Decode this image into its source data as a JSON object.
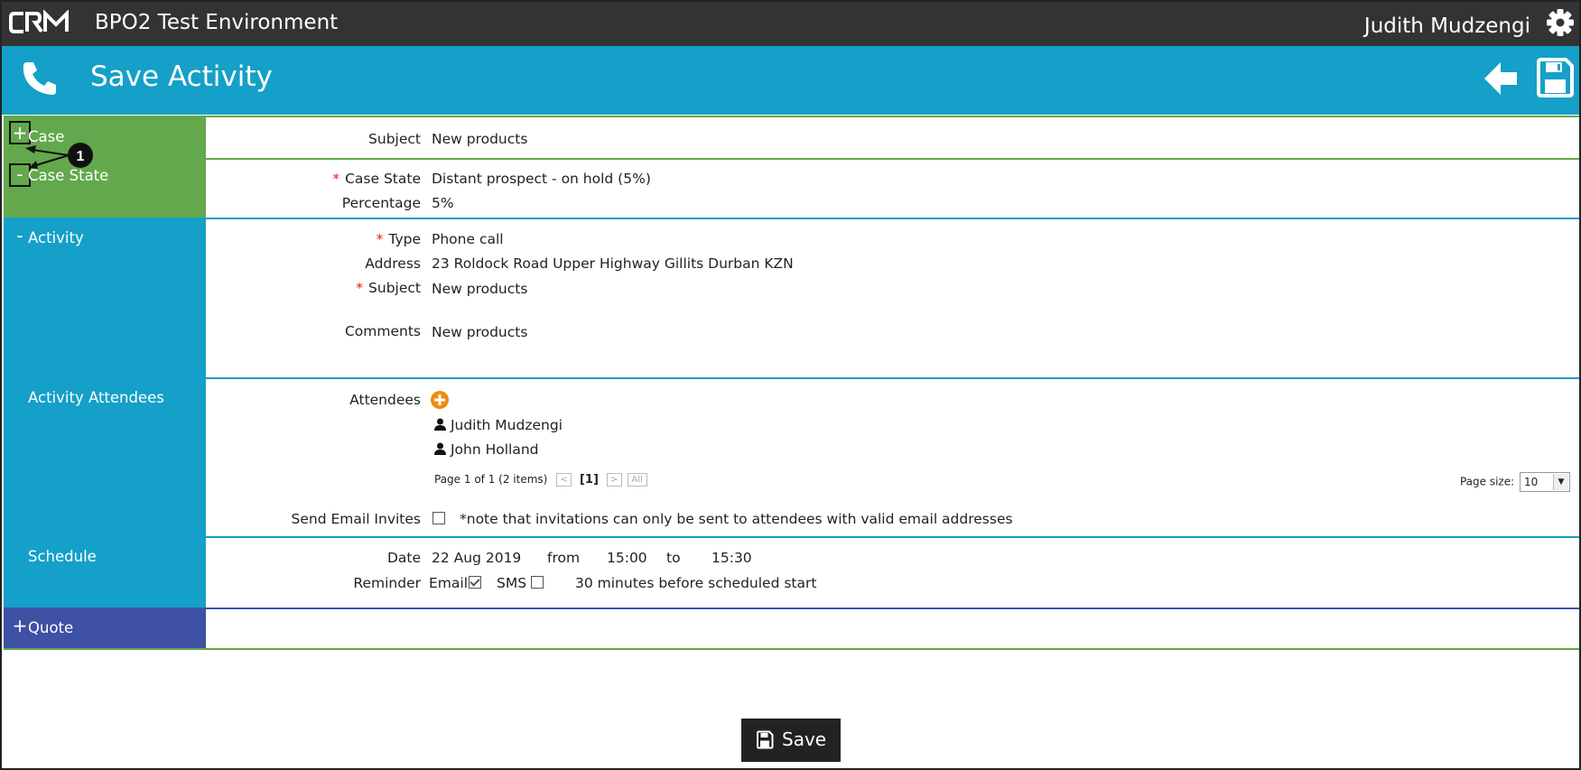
{
  "app": {
    "logo_text": "CRM",
    "environment_title": "BPO2 Test Environment",
    "user_name": "Judith Mudzengi"
  },
  "header": {
    "title": "Save Activity",
    "icons": [
      "phone-icon",
      "back-arrow-icon",
      "save-disk-icon"
    ]
  },
  "annotation": {
    "callout_number": "1"
  },
  "sections": {
    "case": {
      "toggle": "+",
      "label": "Case",
      "subject_label": "Subject",
      "subject_value": "New products"
    },
    "case_state": {
      "toggle": "-",
      "label": "Case State",
      "case_state_label": "Case State",
      "case_state_value": "Distant prospect - on hold (5%)",
      "percentage_label": "Percentage",
      "percentage_value": "5%"
    },
    "activity": {
      "toggle": "-",
      "label": "Activity",
      "type_label": "Type",
      "type_value": "Phone call",
      "address_label": "Address",
      "address_value": "23 Roldock Road Upper Highway Gillits Durban KZN",
      "subject_label": "Subject",
      "subject_value": "New products",
      "comments_label": "Comments",
      "comments_value": "New products"
    },
    "attendees": {
      "label": "Activity Attendees",
      "attendees_label": "Attendees",
      "list": [
        "Judith Mudzengi",
        "John Holland"
      ],
      "pager_text": "Page 1 of 1 (2 items)",
      "pager_prev": "<",
      "pager_current": "[1]",
      "pager_next": ">",
      "pager_all": "All",
      "page_size_label": "Page size:",
      "page_size_value": "10",
      "send_invites_label": "Send Email Invites",
      "send_invites_checked": false,
      "invites_note": "*note that invitations can only be sent to attendees with valid email addresses"
    },
    "schedule": {
      "label": "Schedule",
      "date_label": "Date",
      "date_value": "22 Aug 2019",
      "from_label": "from",
      "from_value": "15:00",
      "to_label": "to",
      "to_value": "15:30",
      "reminder_label": "Reminder",
      "email_label": "Email",
      "email_checked": true,
      "sms_label": "SMS",
      "sms_checked": false,
      "reminder_text": "30 minutes before scheduled start"
    },
    "quote": {
      "toggle": "+",
      "label": "Quote"
    }
  },
  "footer": {
    "save_label": "Save"
  },
  "colors": {
    "topbar": "#333333",
    "header_blue": "#14a0c8",
    "green_section": "#63a84c",
    "blue_section": "#14a0c8",
    "quote_section": "#3f51a5",
    "required_asterisk": "#e02020",
    "add_button": "#f08a12"
  }
}
